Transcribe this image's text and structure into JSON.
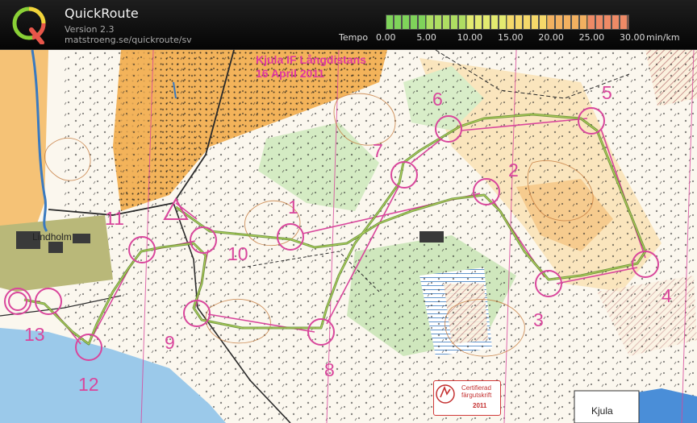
{
  "app": {
    "title": "QuickRoute",
    "version": "Version 2.3",
    "url": "matstroeng.se/quickroute/sv"
  },
  "tempo_legend": {
    "label": "Tempo",
    "unit": "min/km",
    "ticks": [
      "0.00",
      "5.00",
      "10.00",
      "15.00",
      "20.00",
      "25.00",
      "30.00"
    ],
    "colors": [
      "#7fd35a",
      "#aedd62",
      "#e3ea70",
      "#f5d86a",
      "#f2b060",
      "#ee8a66"
    ]
  },
  "map": {
    "title_line1": "Kjula IF Långdistans",
    "title_line2": "16 April 2011",
    "place_lindholm": "Lindholm",
    "place_kjula": "Kjula",
    "badge": {
      "title": "Certifierad",
      "subtitle": "färgutskrift",
      "year": "2011"
    },
    "controls": [
      {
        "label": "1"
      },
      {
        "label": "2"
      },
      {
        "label": "3"
      },
      {
        "label": "4"
      },
      {
        "label": "5"
      },
      {
        "label": "6"
      },
      {
        "label": "7"
      },
      {
        "label": "8"
      },
      {
        "label": "9"
      },
      {
        "label": "10"
      },
      {
        "label": "11"
      },
      {
        "label": "12"
      },
      {
        "label": "13"
      }
    ],
    "colors": {
      "course": "#d9469c",
      "route": "#5a8a2a",
      "open_land": "#f3b35a",
      "rough_open": "#f7d9a0",
      "green": "#c7e3b2",
      "water": "#9bc9ea"
    }
  }
}
